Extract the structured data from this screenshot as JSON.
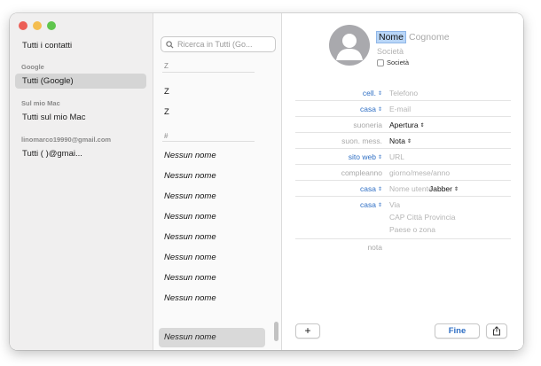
{
  "sidebar": {
    "all_contacts": "Tutti i contatti",
    "groups": [
      {
        "header": "Google",
        "item": "Tutti (Google)",
        "selected": true
      },
      {
        "header": "Sul mio Mac",
        "item": "Tutti sul mio Mac",
        "selected": false
      },
      {
        "header": "linomarco19990@gmail.com",
        "item": "Tutti (                    )@gmai...",
        "selected": false
      }
    ]
  },
  "list": {
    "search_placeholder": "Ricerca in Tutti (Go...",
    "section_z": "Z",
    "z_entries": [
      "Z",
      "Z"
    ],
    "section_hash": "#",
    "hash_entries": [
      "Nessun nome",
      "Nessun nome",
      "Nessun nome",
      "Nessun nome",
      "Nessun nome",
      "Nessun nome",
      "Nessun nome",
      "Nessun nome"
    ],
    "selected_entry": "Nessun nome"
  },
  "card": {
    "first_name": "Nome",
    "last_name_placeholder": "Cognome",
    "company_placeholder": "Società",
    "company_checkbox_label": "Società",
    "fields": [
      {
        "label": "cell.",
        "label_style": "blue",
        "value": "Telefono",
        "value_style": "ph",
        "has_arrow": true
      },
      {
        "label": "casa",
        "label_style": "blue",
        "value": "E-mail",
        "value_style": "ph",
        "has_arrow": true
      },
      {
        "label": "suoneria",
        "label_style": "gray",
        "value": "Apertura",
        "value_style": "dark",
        "has_arrow": false,
        "value_arrow": true
      },
      {
        "label": "suon. mess.",
        "label_style": "gray",
        "value": "Nota",
        "value_style": "dark",
        "has_arrow": false,
        "value_arrow": true
      },
      {
        "label": "sito web",
        "label_style": "blue",
        "value": "URL",
        "value_style": "ph",
        "has_arrow": true
      },
      {
        "label": "compleanno",
        "label_style": "gray",
        "value": "giorno/mese/anno",
        "value_style": "ph",
        "has_arrow": false
      },
      {
        "label": "casa",
        "label_style": "blue",
        "value": "Nome utente",
        "value_style": "ph",
        "has_arrow": true,
        "extra": "Jabber"
      }
    ],
    "address": {
      "label": "casa",
      "street": "Via",
      "city_line": "CAP Città Provincia",
      "country": "Paese o zona"
    },
    "note_label": "nota",
    "add_button": "+",
    "done_button": "Fine"
  },
  "colors": {
    "accent": "#2f6fc4",
    "selection": "#b9d6f7"
  }
}
